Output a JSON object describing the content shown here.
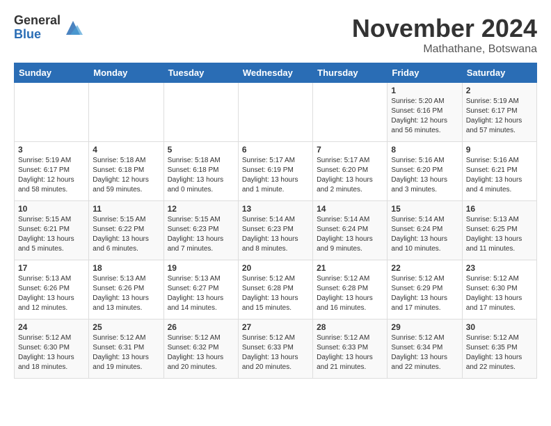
{
  "header": {
    "logo_general": "General",
    "logo_blue": "Blue",
    "month_title": "November 2024",
    "location": "Mathathane, Botswana"
  },
  "weekdays": [
    "Sunday",
    "Monday",
    "Tuesday",
    "Wednesday",
    "Thursday",
    "Friday",
    "Saturday"
  ],
  "weeks": [
    [
      {
        "day": "",
        "info": ""
      },
      {
        "day": "",
        "info": ""
      },
      {
        "day": "",
        "info": ""
      },
      {
        "day": "",
        "info": ""
      },
      {
        "day": "",
        "info": ""
      },
      {
        "day": "1",
        "info": "Sunrise: 5:20 AM\nSunset: 6:16 PM\nDaylight: 12 hours\nand 56 minutes."
      },
      {
        "day": "2",
        "info": "Sunrise: 5:19 AM\nSunset: 6:17 PM\nDaylight: 12 hours\nand 57 minutes."
      }
    ],
    [
      {
        "day": "3",
        "info": "Sunrise: 5:19 AM\nSunset: 6:17 PM\nDaylight: 12 hours\nand 58 minutes."
      },
      {
        "day": "4",
        "info": "Sunrise: 5:18 AM\nSunset: 6:18 PM\nDaylight: 12 hours\nand 59 minutes."
      },
      {
        "day": "5",
        "info": "Sunrise: 5:18 AM\nSunset: 6:18 PM\nDaylight: 13 hours\nand 0 minutes."
      },
      {
        "day": "6",
        "info": "Sunrise: 5:17 AM\nSunset: 6:19 PM\nDaylight: 13 hours\nand 1 minute."
      },
      {
        "day": "7",
        "info": "Sunrise: 5:17 AM\nSunset: 6:20 PM\nDaylight: 13 hours\nand 2 minutes."
      },
      {
        "day": "8",
        "info": "Sunrise: 5:16 AM\nSunset: 6:20 PM\nDaylight: 13 hours\nand 3 minutes."
      },
      {
        "day": "9",
        "info": "Sunrise: 5:16 AM\nSunset: 6:21 PM\nDaylight: 13 hours\nand 4 minutes."
      }
    ],
    [
      {
        "day": "10",
        "info": "Sunrise: 5:15 AM\nSunset: 6:21 PM\nDaylight: 13 hours\nand 5 minutes."
      },
      {
        "day": "11",
        "info": "Sunrise: 5:15 AM\nSunset: 6:22 PM\nDaylight: 13 hours\nand 6 minutes."
      },
      {
        "day": "12",
        "info": "Sunrise: 5:15 AM\nSunset: 6:23 PM\nDaylight: 13 hours\nand 7 minutes."
      },
      {
        "day": "13",
        "info": "Sunrise: 5:14 AM\nSunset: 6:23 PM\nDaylight: 13 hours\nand 8 minutes."
      },
      {
        "day": "14",
        "info": "Sunrise: 5:14 AM\nSunset: 6:24 PM\nDaylight: 13 hours\nand 9 minutes."
      },
      {
        "day": "15",
        "info": "Sunrise: 5:14 AM\nSunset: 6:24 PM\nDaylight: 13 hours\nand 10 minutes."
      },
      {
        "day": "16",
        "info": "Sunrise: 5:13 AM\nSunset: 6:25 PM\nDaylight: 13 hours\nand 11 minutes."
      }
    ],
    [
      {
        "day": "17",
        "info": "Sunrise: 5:13 AM\nSunset: 6:26 PM\nDaylight: 13 hours\nand 12 minutes."
      },
      {
        "day": "18",
        "info": "Sunrise: 5:13 AM\nSunset: 6:26 PM\nDaylight: 13 hours\nand 13 minutes."
      },
      {
        "day": "19",
        "info": "Sunrise: 5:13 AM\nSunset: 6:27 PM\nDaylight: 13 hours\nand 14 minutes."
      },
      {
        "day": "20",
        "info": "Sunrise: 5:12 AM\nSunset: 6:28 PM\nDaylight: 13 hours\nand 15 minutes."
      },
      {
        "day": "21",
        "info": "Sunrise: 5:12 AM\nSunset: 6:28 PM\nDaylight: 13 hours\nand 16 minutes."
      },
      {
        "day": "22",
        "info": "Sunrise: 5:12 AM\nSunset: 6:29 PM\nDaylight: 13 hours\nand 17 minutes."
      },
      {
        "day": "23",
        "info": "Sunrise: 5:12 AM\nSunset: 6:30 PM\nDaylight: 13 hours\nand 17 minutes."
      }
    ],
    [
      {
        "day": "24",
        "info": "Sunrise: 5:12 AM\nSunset: 6:30 PM\nDaylight: 13 hours\nand 18 minutes."
      },
      {
        "day": "25",
        "info": "Sunrise: 5:12 AM\nSunset: 6:31 PM\nDaylight: 13 hours\nand 19 minutes."
      },
      {
        "day": "26",
        "info": "Sunrise: 5:12 AM\nSunset: 6:32 PM\nDaylight: 13 hours\nand 20 minutes."
      },
      {
        "day": "27",
        "info": "Sunrise: 5:12 AM\nSunset: 6:33 PM\nDaylight: 13 hours\nand 20 minutes."
      },
      {
        "day": "28",
        "info": "Sunrise: 5:12 AM\nSunset: 6:33 PM\nDaylight: 13 hours\nand 21 minutes."
      },
      {
        "day": "29",
        "info": "Sunrise: 5:12 AM\nSunset: 6:34 PM\nDaylight: 13 hours\nand 22 minutes."
      },
      {
        "day": "30",
        "info": "Sunrise: 5:12 AM\nSunset: 6:35 PM\nDaylight: 13 hours\nand 22 minutes."
      }
    ]
  ]
}
